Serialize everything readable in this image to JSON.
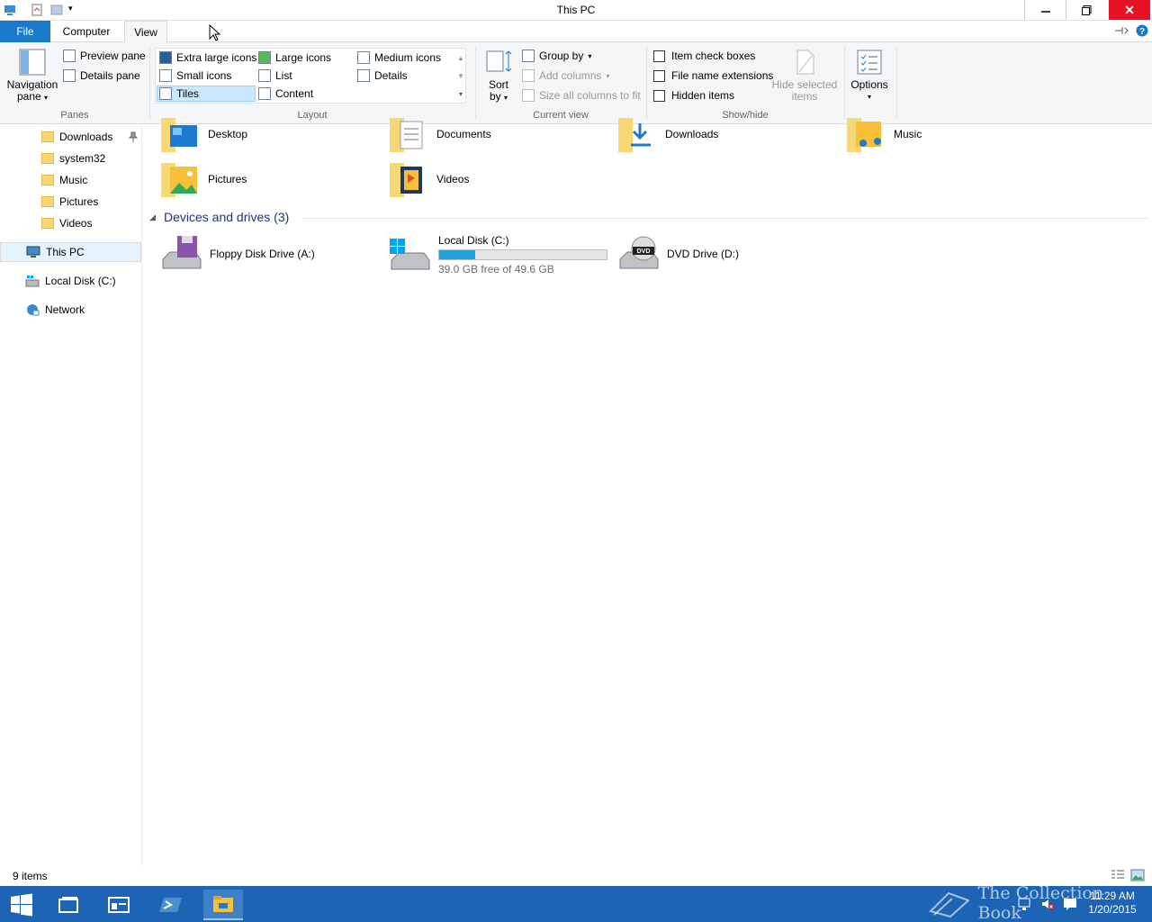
{
  "window": {
    "title": "This PC"
  },
  "tabs": {
    "file": "File",
    "computer": "Computer",
    "view": "View"
  },
  "ribbon": {
    "panes": {
      "navigation_pane": "Navigation",
      "navigation_pane_2": "pane",
      "preview_pane": "Preview pane",
      "details_pane": "Details pane",
      "group_label": "Panes"
    },
    "layout": {
      "extra_large_icons": "Extra large icons",
      "large_icons": "Large icons",
      "medium_icons": "Medium icons",
      "small_icons": "Small icons",
      "list": "List",
      "details": "Details",
      "tiles": "Tiles",
      "content": "Content",
      "group_label": "Layout"
    },
    "current_view": {
      "sort_by": "Sort",
      "sort_by_2": "by",
      "group_by": "Group by",
      "add_columns": "Add columns",
      "size_all_columns": "Size all columns to fit",
      "group_label": "Current view"
    },
    "show_hide": {
      "item_check_boxes": "Item check boxes",
      "file_name_extensions": "File name extensions",
      "hidden_items": "Hidden items",
      "hide_selected": "Hide selected",
      "hide_selected_2": "items",
      "group_label": "Show/hide"
    },
    "options": {
      "label": "Options"
    }
  },
  "nav": {
    "items": [
      {
        "label": "Downloads",
        "pinned": true
      },
      {
        "label": "system32"
      },
      {
        "label": "Music"
      },
      {
        "label": "Pictures"
      },
      {
        "label": "Videos"
      }
    ],
    "this_pc": "This PC",
    "local_disk": "Local Disk (C:)",
    "network": "Network"
  },
  "content": {
    "folders": [
      "Desktop",
      "Documents",
      "Downloads",
      "Music",
      "Pictures",
      "Videos"
    ],
    "group_header": "Devices and drives (3)",
    "drives": {
      "floppy": "Floppy Disk Drive (A:)",
      "local": {
        "label": "Local Disk (C:)",
        "free_text": "39.0 GB free of 49.6 GB",
        "used_fraction": 0.214
      },
      "dvd": "DVD Drive (D:)"
    }
  },
  "status": {
    "items": "9 items"
  },
  "taskbar": {
    "time": "11:29 AM",
    "date": "1/20/2015",
    "watermark": "The Collection Book"
  },
  "colors": {
    "file_tab": "#1979ca",
    "close_button": "#e81123",
    "taskbar": "#1e64b4",
    "drive_bar_fill": "#26a0da",
    "group_header_text": "#1e3287"
  }
}
